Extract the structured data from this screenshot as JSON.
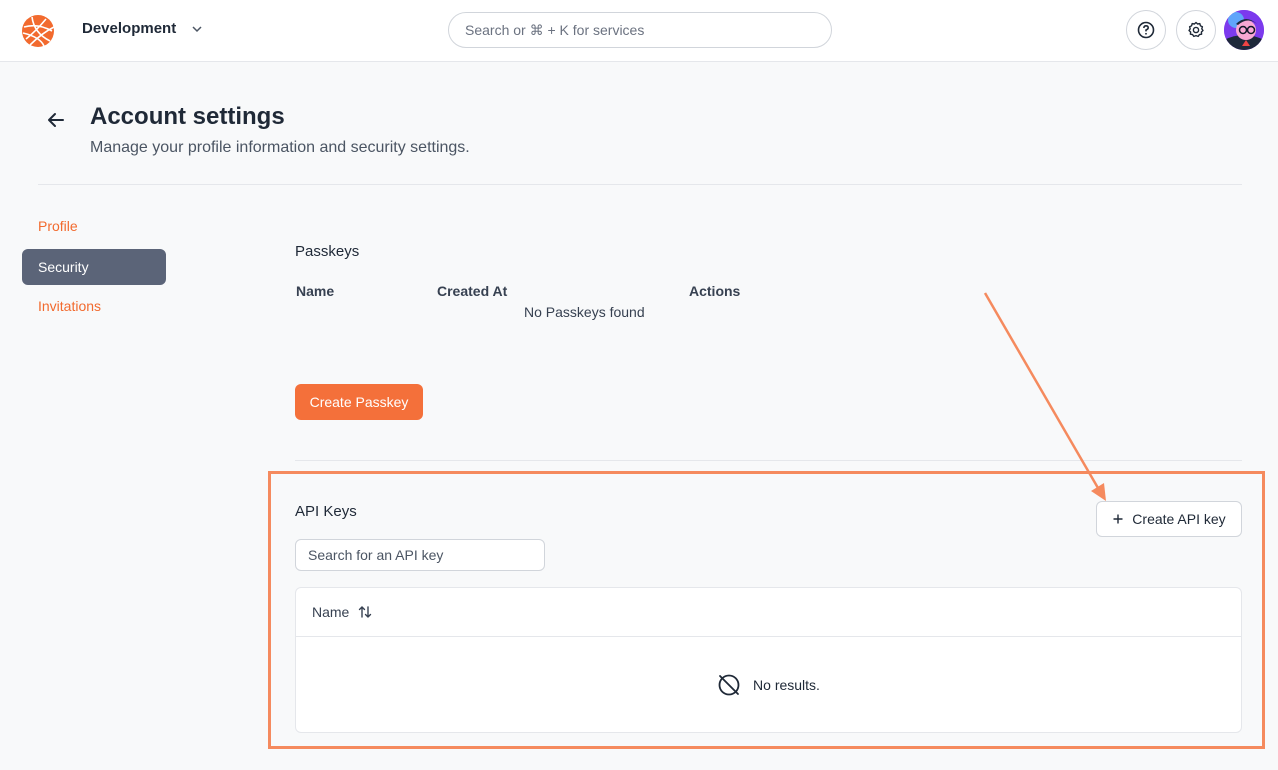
{
  "header": {
    "workspace": "Development",
    "search_placeholder": "Search or ⌘ + K for services"
  },
  "page": {
    "title": "Account settings",
    "subtitle": "Manage your profile information and security settings."
  },
  "sidebar": {
    "items": [
      {
        "label": "Profile",
        "active": false
      },
      {
        "label": "Security",
        "active": true
      },
      {
        "label": "Invitations",
        "active": false
      }
    ]
  },
  "passkeys": {
    "title": "Passkeys",
    "columns": [
      "Name",
      "Created At",
      "Actions"
    ],
    "empty_text": "No Passkeys found",
    "create_button": "Create Passkey"
  },
  "api_keys": {
    "title": "API Keys",
    "create_button": "Create API key",
    "search_placeholder": "Search for an API key",
    "column_name": "Name",
    "empty_text": "No results."
  },
  "colors": {
    "accent": "#f4703a",
    "nav_active_bg": "#5b6478",
    "highlight": "#f58a5e"
  },
  "icons": [
    "logo-icon",
    "chevron-down-icon",
    "help-icon",
    "gear-icon",
    "back-arrow-icon",
    "plus-icon",
    "sort-icon",
    "no-results-icon"
  ]
}
